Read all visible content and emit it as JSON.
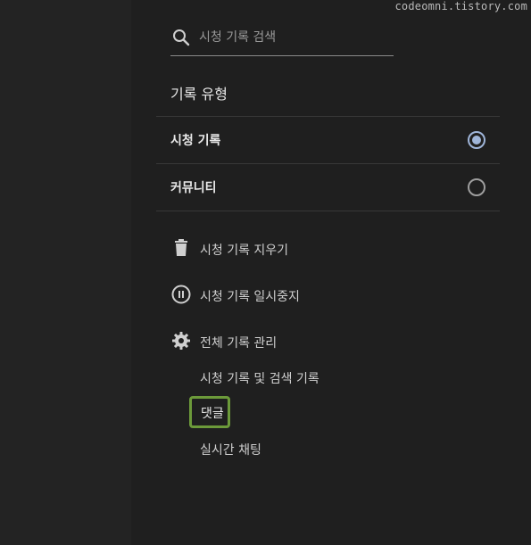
{
  "watermark": "codeomni.tistory.com",
  "search": {
    "placeholder": "시청 기록 검색",
    "icon": "search-icon"
  },
  "history_type": {
    "title": "기록 유형",
    "options": [
      {
        "label": "시청 기록",
        "selected": true
      },
      {
        "label": "커뮤니티",
        "selected": false
      }
    ]
  },
  "actions": {
    "clear": {
      "label": "시청 기록 지우기",
      "icon": "trash-icon"
    },
    "pause": {
      "label": "시청 기록 일시중지",
      "icon": "pause-icon"
    },
    "manage": {
      "label": "전체 기록 관리",
      "icon": "gear-icon"
    }
  },
  "manage_links": {
    "history": "시청 기록 및 검색 기록",
    "comments": "댓글",
    "live_chat": "실시간 채팅"
  },
  "colors": {
    "background": "#1f1f1f",
    "radio_selected": "#9fb5d9",
    "highlight_border": "#6c9a3a"
  }
}
